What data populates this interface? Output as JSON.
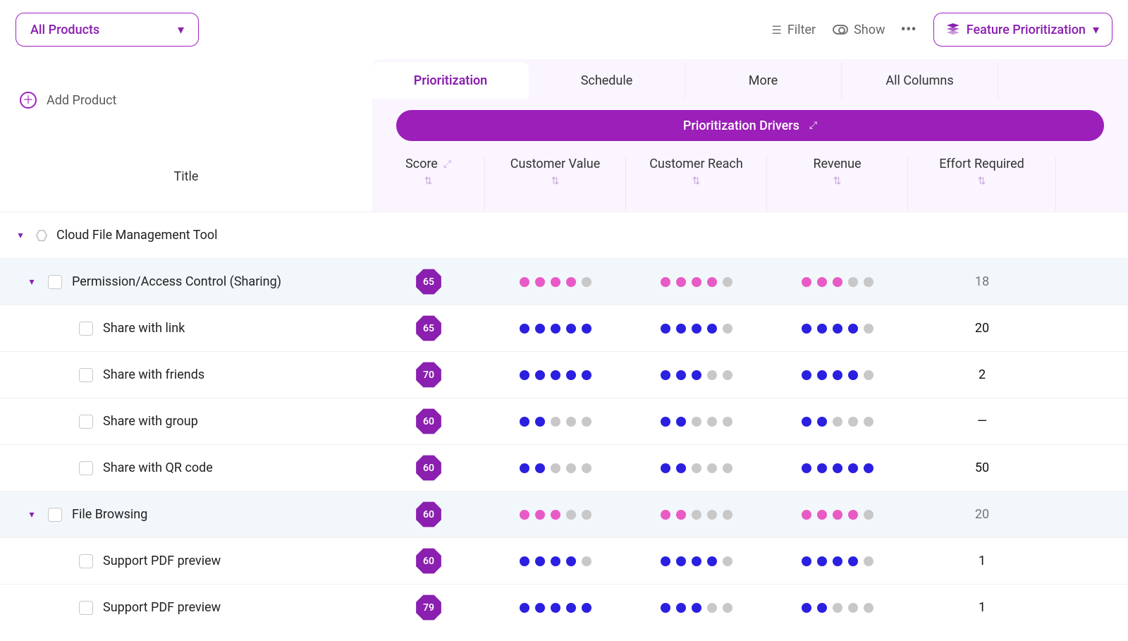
{
  "header": {
    "product_select": "All Products",
    "filter": "Filter",
    "show": "Show",
    "view_select": "Feature Prioritization"
  },
  "add_product_label": "Add Product",
  "tabs": [
    "Prioritization",
    "Schedule",
    "More",
    "All Columns"
  ],
  "active_tab": 0,
  "drivers_button": "Prioritization Drivers",
  "columns": {
    "title": "Title",
    "score": "Score",
    "metrics": [
      "Customer Value",
      "Customer Reach",
      "Revenue"
    ],
    "effort": "Effort Required"
  },
  "dot_max": 5,
  "rows": [
    {
      "type": "group",
      "title": "Cloud File Management Tool"
    },
    {
      "type": "parent",
      "title": "Permission/Access Control (Sharing)",
      "score": 65,
      "dots_style": "pink",
      "dots": [
        4,
        4,
        3
      ],
      "effort": "18"
    },
    {
      "type": "leaf",
      "title": "Share with link",
      "score": 65,
      "dots_style": "blue",
      "dots": [
        5,
        4,
        4
      ],
      "effort": "20"
    },
    {
      "type": "leaf",
      "title": "Share with friends",
      "score": 70,
      "dots_style": "blue",
      "dots": [
        5,
        3,
        4
      ],
      "effort": "2"
    },
    {
      "type": "leaf",
      "title": "Share with group",
      "score": 60,
      "dots_style": "blue",
      "dots": [
        2,
        2,
        2
      ],
      "effort": "—"
    },
    {
      "type": "leaf",
      "title": "Share with QR code",
      "score": 60,
      "dots_style": "blue",
      "dots": [
        2,
        2,
        5
      ],
      "effort": "50"
    },
    {
      "type": "parent",
      "title": "File Browsing",
      "score": 60,
      "dots_style": "pink",
      "dots": [
        3,
        2,
        4
      ],
      "effort": "20"
    },
    {
      "type": "leaf",
      "title": "Support PDF preview",
      "score": 60,
      "dots_style": "blue",
      "dots": [
        4,
        4,
        4
      ],
      "effort": "1"
    },
    {
      "type": "leaf",
      "title": "Support PDF preview",
      "score": 79,
      "dots_style": "blue",
      "dots": [
        5,
        3,
        2
      ],
      "effort": "1"
    }
  ]
}
